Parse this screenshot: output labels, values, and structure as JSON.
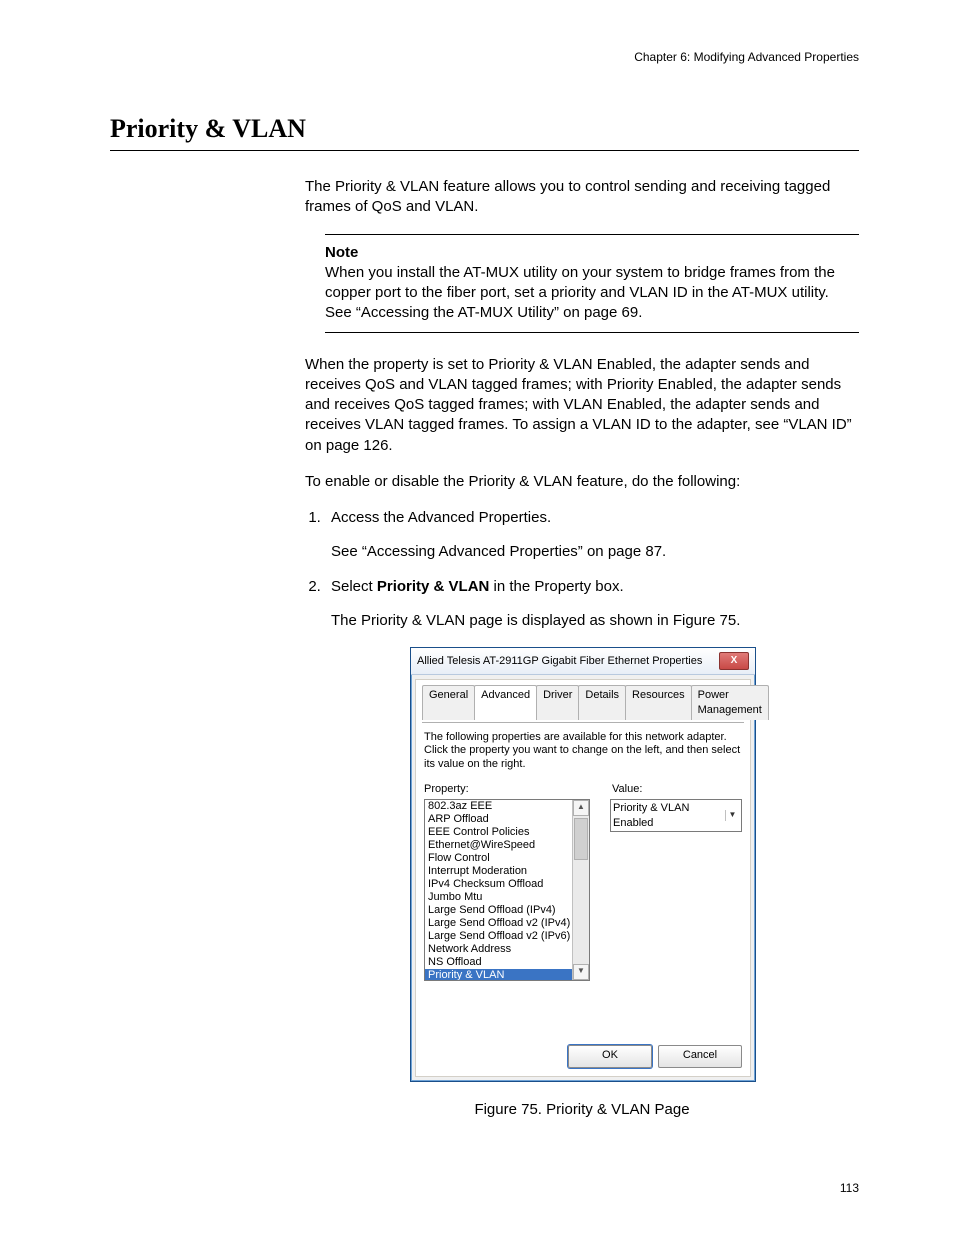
{
  "chapter_header": "Chapter 6: Modifying Advanced Properties",
  "section_title": "Priority & VLAN",
  "intro_para": "The Priority & VLAN feature allows you to control sending and receiving tagged frames of QoS and VLAN.",
  "note": {
    "label": "Note",
    "text": "When you install the AT-MUX utility on your system to bridge frames from the copper port to the fiber port, set a priority and VLAN ID in the AT-MUX utility. See “Accessing the AT-MUX Utility” on page 69."
  },
  "explain_para": "When the property is set to Priority & VLAN Enabled, the adapter sends and receives QoS and VLAN tagged frames; with Priority Enabled, the adapter sends and receives QoS tagged frames; with VLAN Enabled, the adapter sends and receives VLAN tagged frames. To assign a VLAN ID to the adapter, see “VLAN ID” on page 126.",
  "enable_para": "To enable or disable the Priority & VLAN feature, do the following:",
  "steps": [
    {
      "text": "Access the Advanced Properties.",
      "sub": "See “Accessing Advanced Properties” on page 87."
    },
    {
      "text_pre": "Select ",
      "text_bold": "Priority & VLAN",
      "text_post": " in the Property box.",
      "sub": "The Priority & VLAN page is displayed as shown in Figure 75."
    }
  ],
  "dialog": {
    "title": "Allied Telesis AT-2911GP Gigabit Fiber Ethernet Properties",
    "close_glyph": "X",
    "tabs": [
      "General",
      "Advanced",
      "Driver",
      "Details",
      "Resources",
      "Power Management"
    ],
    "active_tab_index": 1,
    "instructions": "The following properties are available for this network adapter. Click the property you want to change on the left, and then select its value on the right.",
    "property_label": "Property:",
    "value_label": "Value:",
    "properties": [
      "802.3az EEE",
      "ARP Offload",
      "EEE Control Policies",
      "Ethernet@WireSpeed",
      "Flow Control",
      "Interrupt Moderation",
      "IPv4 Checksum Offload",
      "Jumbo Mtu",
      "Large Send Offload (IPv4)",
      "Large Send Offload v2 (IPv4)",
      "Large Send Offload v2 (IPv6)",
      "Network Address",
      "NS Offload",
      "Priority & VLAN"
    ],
    "selected_property_index": 13,
    "value_selected": "Priority & VLAN Enabled",
    "ok_label": "OK",
    "cancel_label": "Cancel"
  },
  "figure_caption": "Figure 75. Priority & VLAN Page",
  "page_number": "113"
}
